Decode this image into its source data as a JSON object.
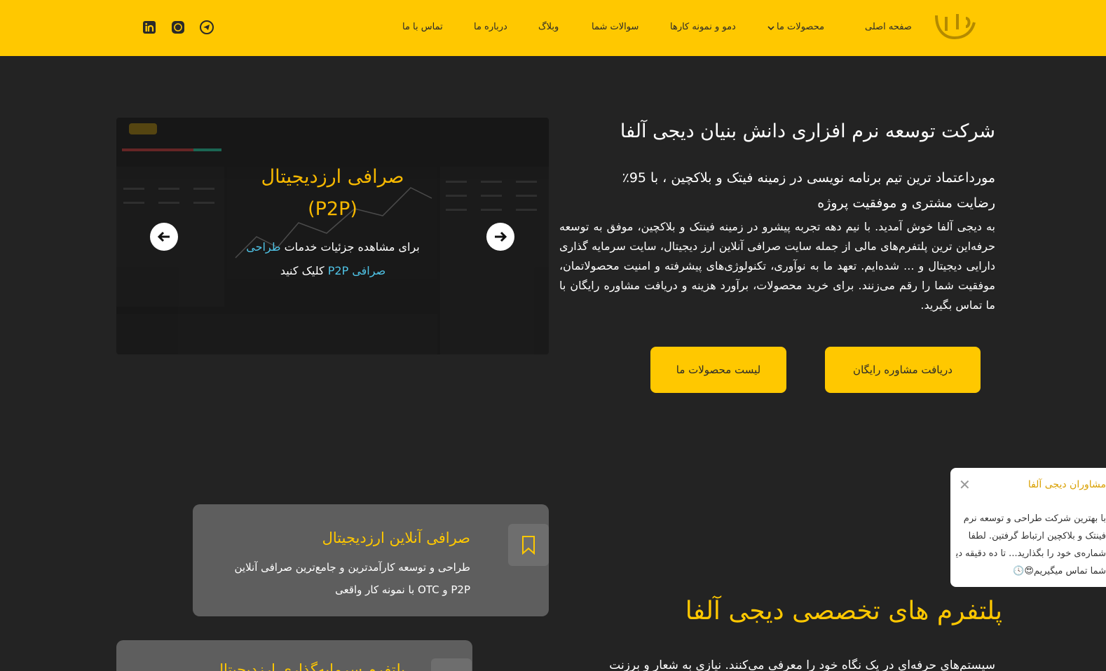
{
  "header": {
    "logo": "دیجی آلفا",
    "nav": [
      {
        "label": "صفحه اصلی"
      },
      {
        "label": "محصولات ما"
      },
      {
        "label": "دمو و نمونه کارها"
      },
      {
        "label": "سوالات شما"
      },
      {
        "label": "وبلاگ"
      },
      {
        "label": "درباره ما"
      },
      {
        "label": "تماس با ما"
      }
    ],
    "social": [
      "telegram-icon",
      "whatsapp-icon",
      "linkedin-icon"
    ]
  },
  "hero": {
    "title": "شرکت توسعه نرم افزاری دانش بنیان دیجی آلفا",
    "subtitle": "مورداعتماد ترین تیم برنامه نویسی در زمینه فیتک و بلاکچین ، با 95٪ رضایت مشتری و موفقیت پروژه",
    "body": "به دیجی آلفا خوش آمدید. با نیم دهه تجربه پیشرو در زمینه فینتک و بلاکچین، موفق به توسعه حرفه‌این ترین پلتفرم‌های مالی از جمله سایت صرافی آنلاین ارز دیجیتال، سایت سرمایه گذاری دارایی دیجیتال و ... شده‌ایم. تعهد ما به نوآوری، تکنولوژی‌های پیشرفته و امنیت محصولاتمان، موفقیت شما را رقم می‌زنند. برای خرید محصولات، برآورد هزینه و دریافت مشاوره رایگان با ما تماس بگیرید.",
    "btn_consult": "دریافت مشاوره رایگان",
    "btn_products": "لیست محصولات ما"
  },
  "slider": {
    "title_line1": "صرافی ارزدیجیتال",
    "title_line2": "(P2P)",
    "text_before": "برای مشاهده جزئیات خدمات",
    "text_highlight": "طراحی صرافی P2P",
    "text_after": "کلیک کنید"
  },
  "cards": [
    {
      "title": "صرافی آنلاین ارزدیجیتال",
      "text": "طراحی و توسعه کارآمدترین و جامع‌ترین صرافی آنلاین P2P و OTC با نمونه کار واقعی"
    },
    {
      "title": "پلتفرم سرمایه‌گذاری ارزدیجیتال"
    }
  ],
  "platforms": {
    "title": "پلتفرم های تخصصی دیجی آلفا",
    "body": "سیستم‌های حرفه‌ای در یک نگاه خود را معرفی می‌کنند. نیازی به شعار و برزنت"
  },
  "popup": {
    "title": "مشاوران دیجی آلفا",
    "line1": "با بهترین شرکت طراحی و توسعه نرم",
    "line2": "فینتک و بلاکچین ارتباط گرفتین. لطفا",
    "line3": "شماره‌ی خود را بگذارید... تا ده دقیقه دیگر با",
    "line4": "شما تماس میگیریم😍🕓"
  },
  "colors": {
    "brand": "#ffc800",
    "bg": "#232323",
    "card": "#5e5e5e"
  }
}
